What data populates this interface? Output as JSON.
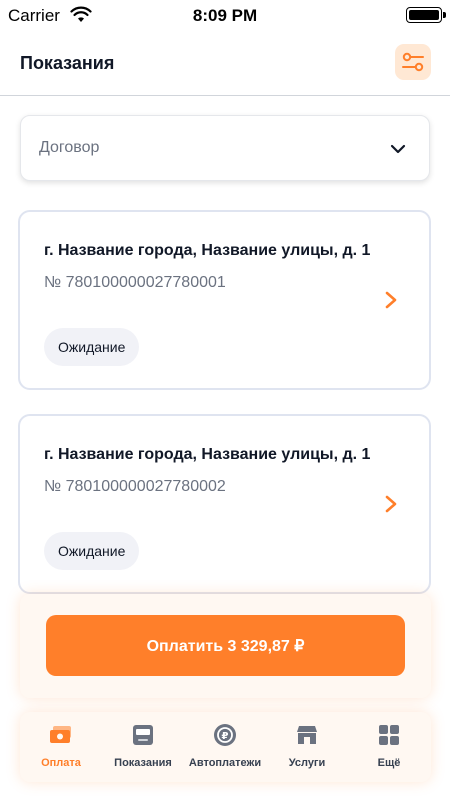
{
  "status_bar": {
    "carrier": "Carrier",
    "time": "8:09 PM"
  },
  "header": {
    "title": "Показания"
  },
  "contract_select": {
    "label": "Договор"
  },
  "cards": [
    {
      "address": "г. Название города, Название улицы, д. 1",
      "number": "№ 780100000027780001",
      "status": "Ожидание"
    },
    {
      "address": "г. Название города, Название улицы, д. 1",
      "number": "№ 780100000027780002",
      "status": "Ожидание"
    }
  ],
  "pay_button": {
    "label": "Оплатить 3 329,87 ₽"
  },
  "tabs": [
    {
      "label": "Оплата",
      "icon": "payment-icon",
      "active": true
    },
    {
      "label": "Показания",
      "icon": "meter-icon",
      "active": false
    },
    {
      "label": "Автоплатежи",
      "icon": "autopay-icon",
      "active": false
    },
    {
      "label": "Услуги",
      "icon": "store-icon",
      "active": false
    },
    {
      "label": "Ещё",
      "icon": "grid-icon",
      "active": false
    }
  ],
  "colors": {
    "accent": "#ff7f2a",
    "accent_light": "#ffe8d4",
    "card_border": "#dfe4f0",
    "badge_bg": "#f1f2f7"
  }
}
